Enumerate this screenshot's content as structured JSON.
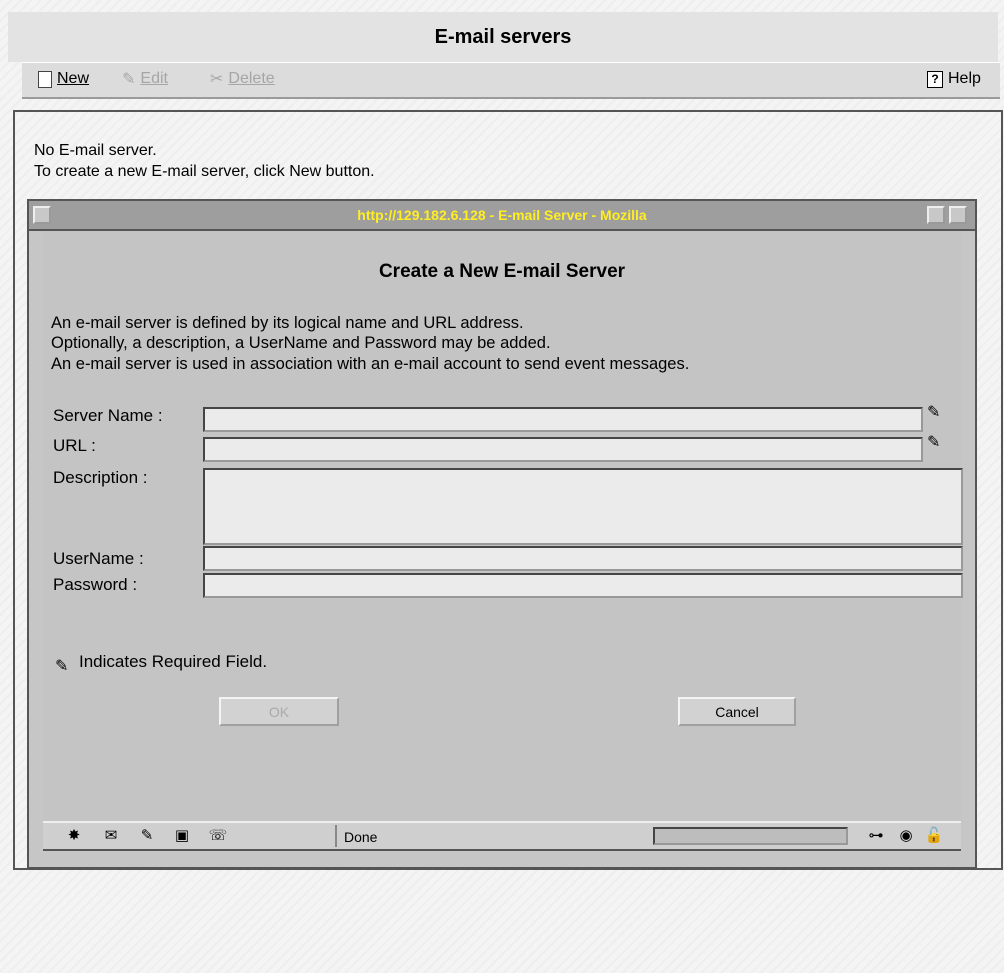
{
  "window": {
    "title": "E-mail servers"
  },
  "toolbar": {
    "new_label": "New",
    "edit_label": "Edit",
    "delete_label": "Delete",
    "help_label": "Help"
  },
  "page": {
    "no_server": "No E-mail server.",
    "create_hint": "To create a new E-mail server, click New button."
  },
  "popup": {
    "title": "http://129.182.6.128 - E-mail Server - Mozilla",
    "heading": "Create a New E-mail Server",
    "description": [
      "An e-mail server is defined by its logical name and URL address.",
      "Optionally, a description, a UserName and Password may be added.",
      "An e-mail server is used in association with an e-mail account to send event messages."
    ],
    "fields": {
      "server_name_label": "Server Name :",
      "url_label": "URL :",
      "description_label": "Description :",
      "username_label": "UserName :",
      "password_label": "Password :",
      "server_name_value": "",
      "url_value": "",
      "description_value": "",
      "username_value": "",
      "password_value": ""
    },
    "required_note": "Indicates Required Field.",
    "ok_label": "OK",
    "cancel_label": "Cancel",
    "status_text": "Done"
  },
  "icons": [
    "new-document-icon",
    "edit-icon",
    "delete-icon",
    "help-icon",
    "required-field-icon"
  ]
}
